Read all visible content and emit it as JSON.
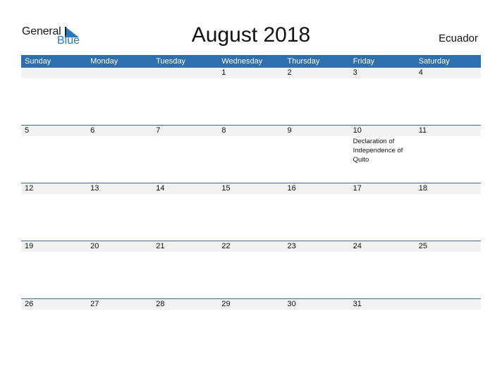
{
  "logo": {
    "text_general": "General",
    "text_blue": "Blue"
  },
  "title": "August 2018",
  "country": "Ecuador",
  "colors": {
    "header_bg": "#2e6fb0",
    "accent": "#2a7ac0",
    "date_strip": "#f2f2f2"
  },
  "weekdays": [
    "Sunday",
    "Monday",
    "Tuesday",
    "Wednesday",
    "Thursday",
    "Friday",
    "Saturday"
  ],
  "weeks": [
    {
      "days": [
        {
          "day": ""
        },
        {
          "day": ""
        },
        {
          "day": ""
        },
        {
          "day": "1"
        },
        {
          "day": "2"
        },
        {
          "day": "3"
        },
        {
          "day": "4"
        }
      ]
    },
    {
      "days": [
        {
          "day": "5"
        },
        {
          "day": "6"
        },
        {
          "day": "7"
        },
        {
          "day": "8"
        },
        {
          "day": "9"
        },
        {
          "day": "10",
          "event": "Declaration of Independence of Quito"
        },
        {
          "day": "11"
        }
      ]
    },
    {
      "days": [
        {
          "day": "12"
        },
        {
          "day": "13"
        },
        {
          "day": "14"
        },
        {
          "day": "15"
        },
        {
          "day": "16"
        },
        {
          "day": "17"
        },
        {
          "day": "18"
        }
      ]
    },
    {
      "days": [
        {
          "day": "19"
        },
        {
          "day": "20"
        },
        {
          "day": "21"
        },
        {
          "day": "22"
        },
        {
          "day": "23"
        },
        {
          "day": "24"
        },
        {
          "day": "25"
        }
      ]
    },
    {
      "days": [
        {
          "day": "26"
        },
        {
          "day": "27"
        },
        {
          "day": "28"
        },
        {
          "day": "29"
        },
        {
          "day": "30"
        },
        {
          "day": "31"
        },
        {
          "day": ""
        }
      ]
    }
  ]
}
